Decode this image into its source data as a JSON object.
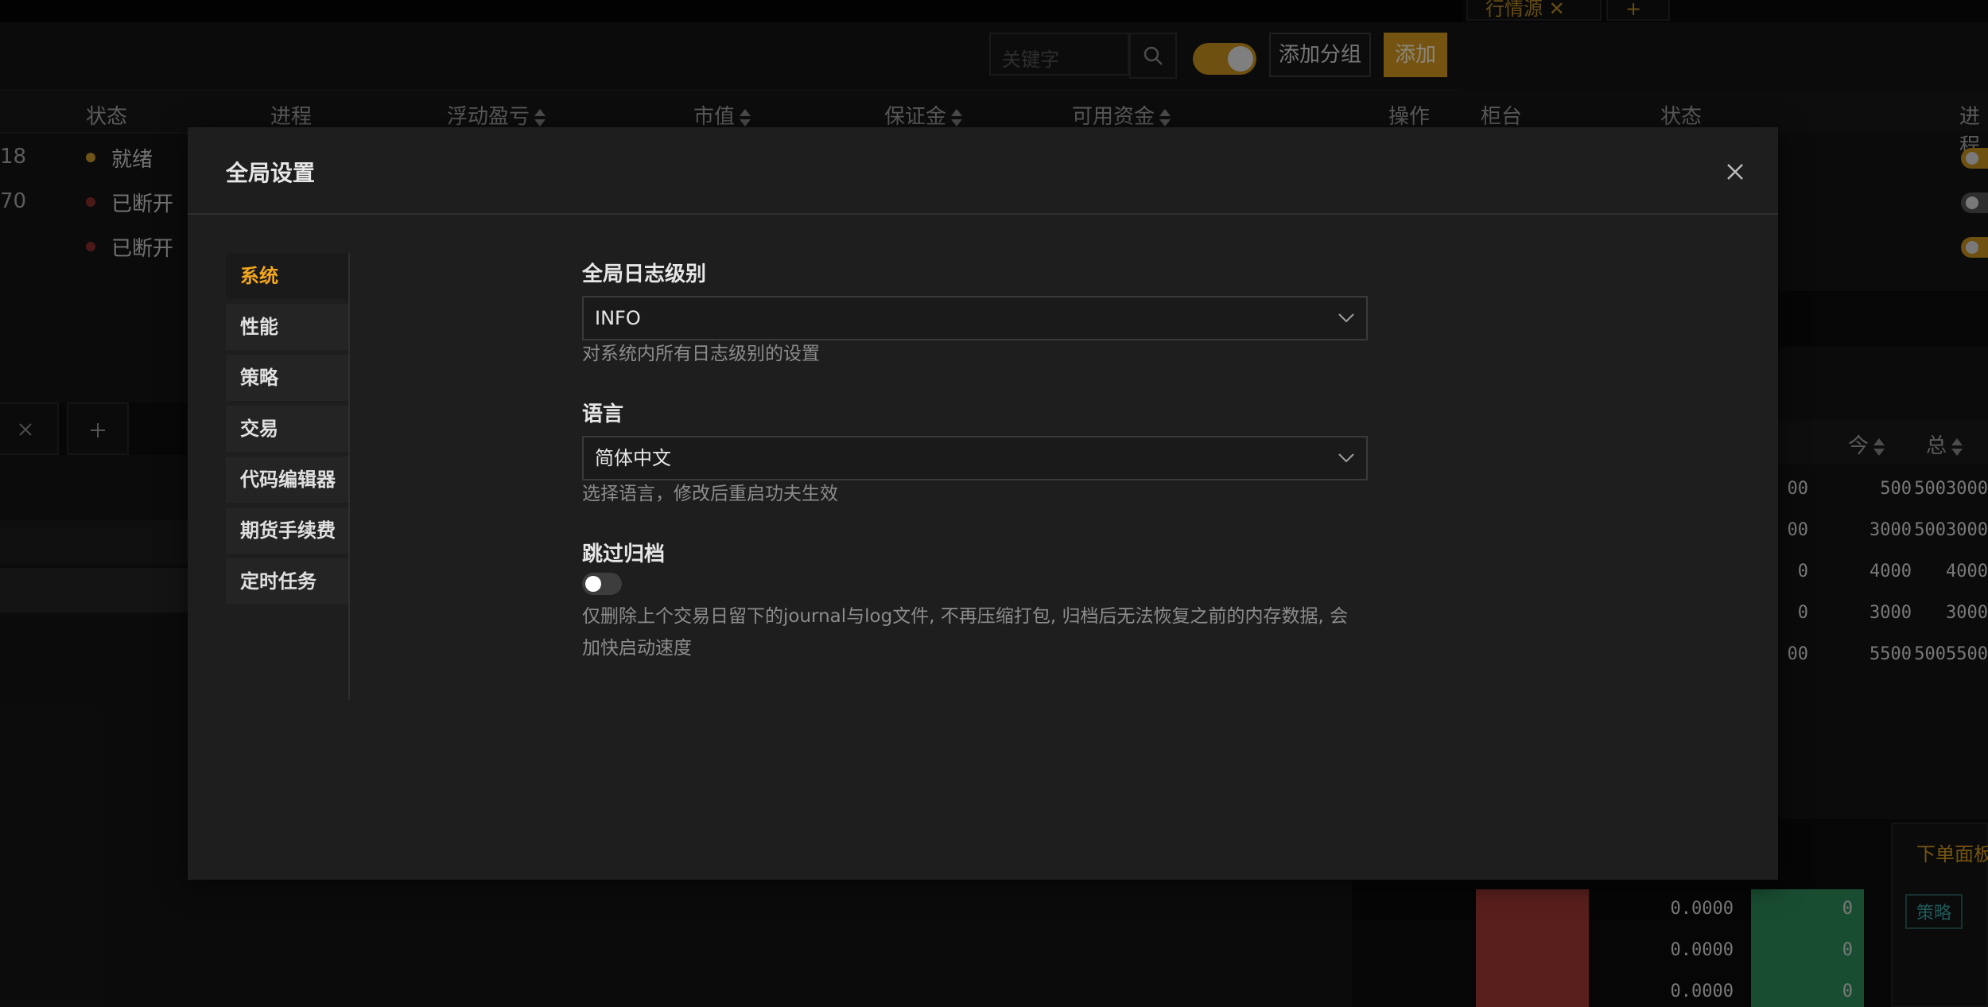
{
  "background": {
    "right_tab_label": "行情源",
    "search_placeholder": "关键字",
    "add_group_label": "添加分组",
    "add_label": "添加",
    "left_headers": [
      "状态",
      "进程",
      "浮动盈亏",
      "市值",
      "保证金",
      "可用资金",
      "操作"
    ],
    "left_rows": [
      {
        "num": "18",
        "status": "就绪",
        "dot_color": "#c89b2a"
      },
      {
        "num": "70",
        "status": "已断开",
        "dot_color": "#8b2e2e"
      },
      {
        "num": "",
        "status": "已断开",
        "dot_color": "#8b2e2e"
      }
    ],
    "right_headers": [
      "柜台",
      "状态",
      "进程"
    ],
    "right_headers2": [
      "今",
      "总"
    ],
    "right_rows": [
      [
        "00",
        "500",
        "5003000"
      ],
      [
        "00",
        "3000",
        "5003000"
      ],
      [
        "0",
        "4000",
        "4000"
      ],
      [
        "0",
        "3000",
        "3000"
      ],
      [
        "00",
        "5500",
        "5005500"
      ]
    ],
    "book_values": [
      "0.0000",
      "0.0000",
      "0.0000"
    ],
    "book_qty": [
      "0",
      "0",
      "0"
    ],
    "order_panel_title": "下单面板",
    "order_tag": "策略",
    "accent_gold": "#d69a22"
  },
  "modal": {
    "title": "全局设置",
    "nav": [
      "系统",
      "性能",
      "策略",
      "交易",
      "代码编辑器",
      "期货手续费",
      "定时任务"
    ],
    "active_nav": "系统",
    "log_level": {
      "label": "全局日志级别",
      "value": "INFO",
      "help": "对系统内所有日志级别的设置"
    },
    "language": {
      "label": "语言",
      "value": "简体中文",
      "help": "选择语言，修改后重启功夫生效"
    },
    "skip_archive": {
      "label": "跳过归档",
      "enabled": false,
      "help_line1": "仅删除上个交易日留下的journal与log文件, 不再压缩打包, 归档后无法恢复之前的内存数据, 会",
      "help_line2": "加快启动速度"
    }
  }
}
